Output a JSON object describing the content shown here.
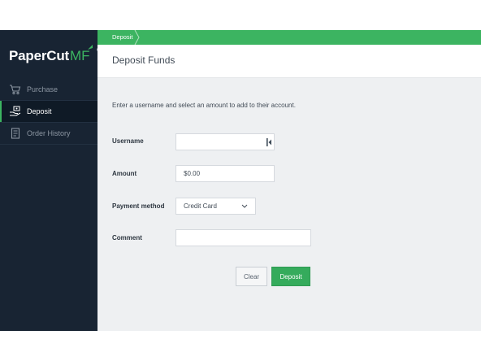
{
  "brand": {
    "name_main": "PaperCut",
    "name_suffix": "MF",
    "accent_color": "#3cb461",
    "sidebar_color": "#182433"
  },
  "sidebar": {
    "items": [
      {
        "label": "Purchase",
        "icon": "cart-icon",
        "active": false
      },
      {
        "label": "Deposit",
        "icon": "hand-money-icon",
        "active": true
      },
      {
        "label": "Order History",
        "icon": "document-icon",
        "active": false
      }
    ]
  },
  "breadcrumb": {
    "current": "Deposit"
  },
  "page": {
    "title": "Deposit Funds",
    "instructions": "Enter a username and select an amount to add to their account."
  },
  "form": {
    "username": {
      "label": "Username",
      "value": "",
      "icon": "user-lookup-icon"
    },
    "amount": {
      "label": "Amount",
      "value": "$0.00"
    },
    "payment_method": {
      "label": "Payment method",
      "value": "Credit Card",
      "icon": "chevron-down-icon"
    },
    "comment": {
      "label": "Comment",
      "value": ""
    }
  },
  "buttons": {
    "clear": "Clear",
    "deposit": "Deposit"
  }
}
